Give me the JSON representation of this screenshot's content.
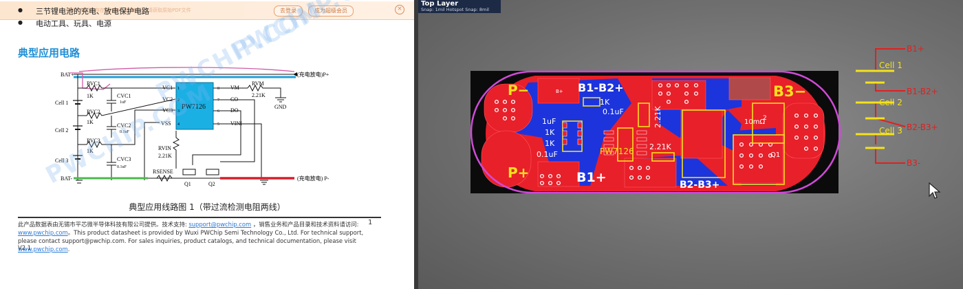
{
  "left_doc": {
    "notice_button_1": "去登录",
    "notice_button_2": "成为超级会员",
    "notice_faint_text": "这份文档可能存在版权和不完整信息，请获取原始PDF文件",
    "bullets": [
      "三节锂电池的充电、放电保护电路",
      "电动工具、玩具、电源"
    ],
    "section_title": "典型应用电路",
    "watermark": "PWCHIP.COM",
    "schematic": {
      "bat_plus": "BAT+",
      "bat_minus": "BAT-",
      "charge_plus": "(充电放电)P+",
      "charge_minus": "(充电放电) P-",
      "cells": [
        "Cell 1",
        "Cell 2",
        "Cell 3"
      ],
      "resistors": [
        "RVC1",
        "RVC2",
        "RVC3"
      ],
      "resistor_values": [
        "1K",
        "1K",
        "1K"
      ],
      "caps": [
        "CVC1",
        "CVC2",
        "CVC3"
      ],
      "cap_values": [
        "1uF",
        "0.1uF",
        "0.1uF"
      ],
      "ic_name": "PW7126",
      "ic_left_pins": [
        "VC1",
        "VC2",
        "VC3",
        "VSS"
      ],
      "ic_right_pins": [
        "VM",
        "CO",
        "DO",
        "VINI"
      ],
      "ic_left_nums": [
        "1",
        "2",
        "3",
        "4"
      ],
      "ic_right_nums": [
        "8",
        "7",
        "6",
        "5"
      ],
      "rvm": "RVM",
      "rvm_value": "2.21K",
      "gnd": "GND",
      "rvin": "RVIN",
      "rvin_value": "2.21K",
      "rsense": "RSENSE",
      "q1": "Q1",
      "q2": "Q2"
    },
    "figure_caption": "典型应用线路图 1（带过流检测电阻两线）",
    "footer_line1_a": "此产品数据表由无锡市平芯微半导体科技有限公司提供。技术支持: ",
    "footer_email": "support@pwchip.com",
    "footer_line1_b": " ，销售业务和产品目录和技术资料请访问: ",
    "footer_url": "www.pwchip.com",
    "footer_line2": "。This product datasheet is provided by Wuxi PWChip Semi Technology Co., Ltd. For technical support, please contact support@pwchip.com. For sales inquiries, product catalogs, and technical documentation, please visit ",
    "footer_url2": "www.pwchip.com",
    "footer_end": ".",
    "page_number": "1",
    "version": "V2.1"
  },
  "pcb": {
    "layer_tab_title": "Top Layer",
    "layer_tab_snap": "Snap: 1mil Hotspot Snap: 8mil",
    "labels": {
      "p_minus": "P−",
      "p_plus": "P+",
      "b1_b2": "B1-B2+",
      "b1_plus": "B1+",
      "b3_minus": "B3−",
      "b2_b3": "B2-B3+",
      "ic": "PW7126",
      "r1": "1K",
      "r2": "1K",
      "r3": "1K",
      "c1": "1uF",
      "c2": "0.1uF",
      "c3": "0.1uF",
      "r_221a": "2.21K",
      "r_221b": "2.21K",
      "r_10m": "10mΩ",
      "q1": "Q1",
      "q2": "2",
      "bp": "B+"
    },
    "annot": {
      "b1p": "B1+",
      "b1b2": "B1-B2+",
      "b2b3": "B2-B3+",
      "b3m": "B3-",
      "cell1": "Cell 1",
      "cell2": "Cell 2",
      "cell3": "Cell 3"
    },
    "colors": {
      "board": "#0a0a0a",
      "copper": "#e8202a",
      "bottom": "#1030e0",
      "silk": "#f4e21b",
      "outline": "#d04ad8",
      "annot": "#e02020"
    }
  }
}
